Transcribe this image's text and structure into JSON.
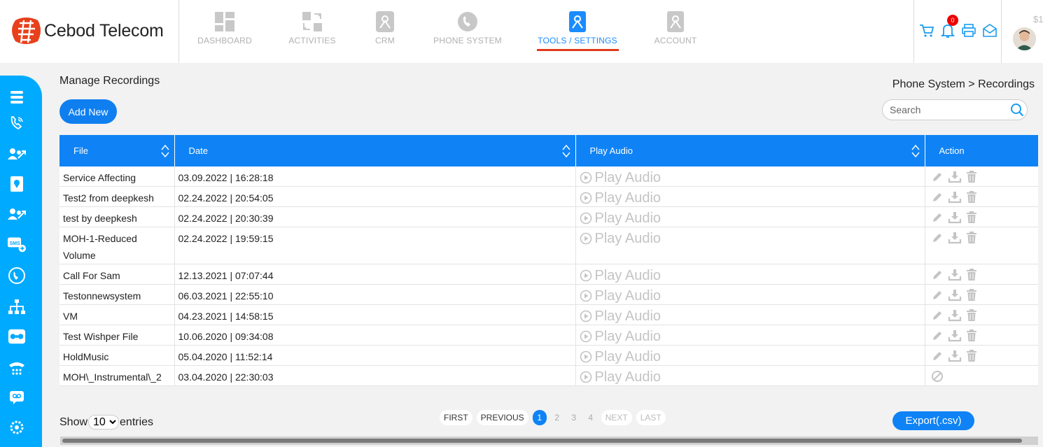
{
  "brand": {
    "name": "Cebod Telecom"
  },
  "nav": [
    {
      "label": "DASHBOARD",
      "icon": "dashboard-icon"
    },
    {
      "label": "ACTIVITIES",
      "icon": "activities-icon"
    },
    {
      "label": "CRM",
      "icon": "crm-icon"
    },
    {
      "label": "PHONE SYSTEM",
      "icon": "phone-system-icon"
    },
    {
      "label": "TOOLS / SETTINGS",
      "icon": "tools-settings-icon",
      "active": true
    },
    {
      "label": "ACCOUNT",
      "icon": "account-icon"
    }
  ],
  "header": {
    "notifications_count": "0",
    "balance": "$1"
  },
  "page": {
    "title": "Manage Recordings",
    "breadcrumb": "Phone System > Recordings",
    "add_button": "Add New",
    "search_placeholder": "Search"
  },
  "table": {
    "columns": [
      "File",
      "Date",
      "Play Audio",
      "Action"
    ],
    "play_label": "Play Audio",
    "rows": [
      {
        "file": "Service Affecting",
        "date": "03.09.2022 | 16:28:18",
        "editable": true
      },
      {
        "file": "Test2 from deepkesh",
        "date": "02.24.2022 | 20:54:05",
        "editable": true
      },
      {
        "file": "test by deepkesh",
        "date": "02.24.2022 | 20:30:39",
        "editable": true
      },
      {
        "file": "MOH-1-Reduced Volume",
        "date": "02.24.2022 | 19:59:15",
        "editable": true
      },
      {
        "file": "Call For Sam",
        "date": "12.13.2021 | 07:07:44",
        "editable": true
      },
      {
        "file": "Testonnewsystem",
        "date": "06.03.2021 | 22:55:10",
        "editable": true
      },
      {
        "file": "VM",
        "date": "04.23.2021 | 14:58:15",
        "editable": true
      },
      {
        "file": "Test Wishper File",
        "date": "10.06.2020 | 09:34:08",
        "editable": true
      },
      {
        "file": "HoldMusic",
        "date": "05.04.2020 | 11:52:14",
        "editable": true
      },
      {
        "file": "MOH\\_Instrumental\\_2",
        "date": "03.04.2020 | 22:30:03",
        "editable": false
      }
    ]
  },
  "footer": {
    "show_label": "Show",
    "entries_label": "entries",
    "page_size": "10",
    "pager": {
      "first": "FIRST",
      "previous": "PREVIOUS",
      "pages": [
        "1",
        "2",
        "3",
        "4"
      ],
      "current": "1",
      "next": "NEXT",
      "last": "LAST"
    },
    "export_label": "Export(.csv)"
  },
  "colors": {
    "accent": "#0f83f5",
    "sidebar": "#00aaff",
    "active_underline": "#e03a1a",
    "icon_gray": "#c4c4c4"
  }
}
